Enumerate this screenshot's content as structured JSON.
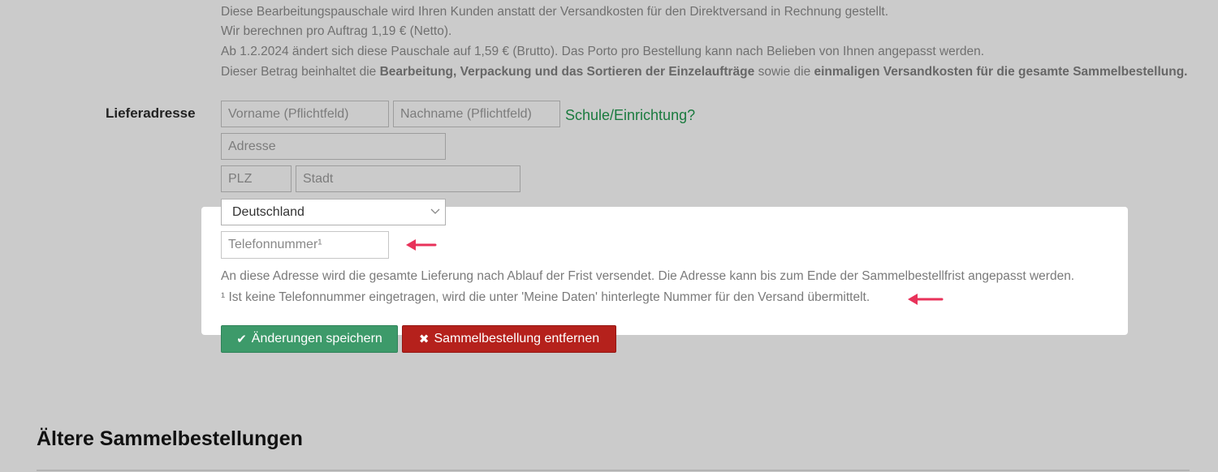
{
  "info": {
    "line1": "Diese Bearbeitungspauschale wird Ihren Kunden anstatt der Versandkosten für den Direktversand in Rechnung gestellt.",
    "line2": "Wir berechnen pro Auftrag 1,19 € (Netto).",
    "line3": "Ab 1.2.2024 ändert sich diese Pauschale auf 1,59 € (Brutto). Das Porto pro Bestellung kann nach Belieben von Ihnen angepasst werden.",
    "line4_pre": "Dieser Betrag beinhaltet die ",
    "line4_bold1": "Bearbeitung, Verpackung und das Sortieren der Einzelaufträge",
    "line4_mid": " sowie die ",
    "line4_bold2": "einmaligen Versandkosten für die gesamte Sammelbestellung."
  },
  "address": {
    "label": "Lieferadresse",
    "firstname_placeholder": "Vorname (Pflichtfeld)",
    "lastname_placeholder": "Nachname (Pflichtfeld)",
    "school_link": "Schule/Einrichtung?",
    "street_placeholder": "Adresse",
    "zip_placeholder": "PLZ",
    "city_placeholder": "Stadt",
    "country_selected": "Deutschland",
    "phone_placeholder": "Telefonnummer¹",
    "note1": "An diese Adresse wird die gesamte Lieferung nach Ablauf der Frist versendet. Die Adresse kann bis zum Ende der Sammelbestellfrist angepasst werden.",
    "note2": "¹ Ist keine Telefonnummer eingetragen, wird die unter 'Meine Daten' hinterlegte Nummer für den Versand übermittelt."
  },
  "buttons": {
    "save_label": "Änderungen speichern",
    "remove_label": "Sammelbestellung entfernen"
  },
  "older": {
    "heading": "Ältere Sammelbestellungen"
  },
  "colors": {
    "arrow": "#e8325a",
    "save": "#3d9a6a",
    "remove": "#b5211c",
    "link": "#1a7a3e"
  },
  "icons": [
    "check-icon",
    "x-icon",
    "chevron-down-icon",
    "arrow-left-icon"
  ]
}
